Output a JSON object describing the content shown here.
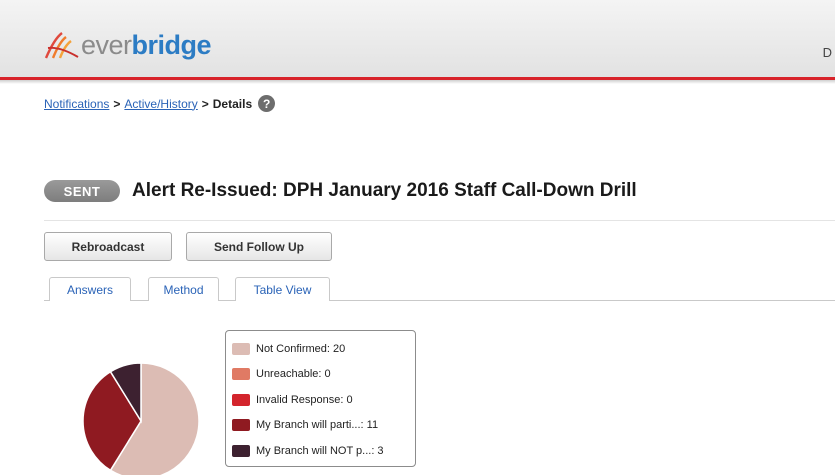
{
  "header": {
    "logo_ever": "ever",
    "logo_bridge": "bridge",
    "right_text": "D"
  },
  "breadcrumb": {
    "items": [
      "Notifications",
      "Active/History",
      "Details"
    ],
    "separator": ">",
    "help_icon": "?"
  },
  "notification": {
    "status": "SENT",
    "title": "Alert Re-Issued: DPH January 2016 Staff Call-Down Drill"
  },
  "actions": {
    "rebroadcast": "Rebroadcast",
    "follow_up": "Send Follow Up"
  },
  "tabs": [
    {
      "label": "Answers",
      "active": true
    },
    {
      "label": "Method",
      "active": false
    },
    {
      "label": "Table View",
      "active": false
    }
  ],
  "chart_data": {
    "type": "pie",
    "series": [
      {
        "name": "Not Confirmed",
        "label": "Not Confirmed: 20",
        "value": 20,
        "color": "#dcbcb4"
      },
      {
        "name": "Unreachable",
        "label": "Unreachable: 0",
        "value": 0,
        "color": "#e07a64"
      },
      {
        "name": "Invalid Response",
        "label": "Invalid Response: 0",
        "value": 0,
        "color": "#d3242c"
      },
      {
        "name": "My Branch will parti...",
        "label": "My Branch will parti...: 11",
        "value": 11,
        "color": "#8f1a21"
      },
      {
        "name": "My Branch will NOT p...",
        "label": "My Branch will NOT p...: 3",
        "value": 3,
        "color": "#3d2130"
      }
    ],
    "legend_position": "right"
  }
}
